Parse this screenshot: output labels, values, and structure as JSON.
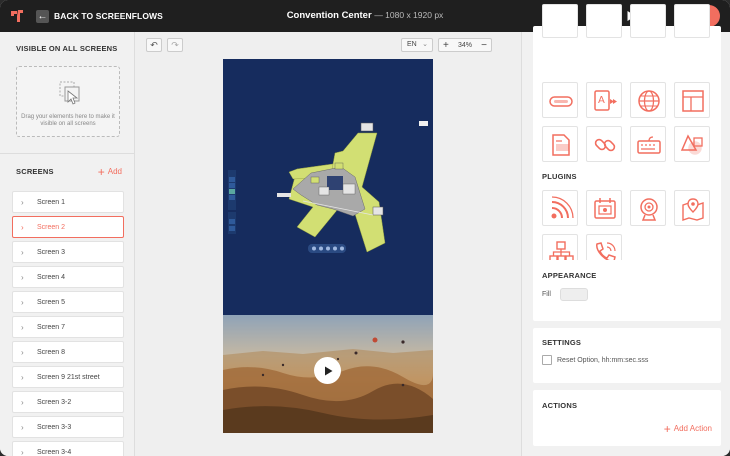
{
  "topbar": {
    "back_label": "BACK TO SCREENFLOWS",
    "title": "Convention Center",
    "title_dims": "— 1080 x 1920 px",
    "icons": [
      "gear-icon",
      "play-icon",
      "save-icon",
      "upload-icon"
    ],
    "accent": "#f26e5f"
  },
  "left": {
    "visible_header": "VISIBLE ON ALL SCREENS",
    "drop_hint": "Drag your elements here to make it visible on all screens",
    "screens_header": "SCREENS",
    "add_label": "Add",
    "screens": [
      {
        "label": "Screen 1",
        "active": false
      },
      {
        "label": "Screen 2",
        "active": true
      },
      {
        "label": "Screen 3",
        "active": false
      },
      {
        "label": "Screen 4",
        "active": false
      },
      {
        "label": "Screen 5",
        "active": false
      },
      {
        "label": "Screen 7",
        "active": false
      },
      {
        "label": "Screen 8",
        "active": false
      },
      {
        "label": "Screen 9 21st street",
        "active": false
      },
      {
        "label": "Screen 3-2",
        "active": false
      },
      {
        "label": "Screen 3-3",
        "active": false
      },
      {
        "label": "Screen 3-4",
        "active": false
      }
    ]
  },
  "canvas": {
    "language": "EN",
    "zoom": "34%"
  },
  "right": {
    "plugins_header": "PLUGINS",
    "appearance_header": "APPEARANCE",
    "fill_label": "Fill",
    "settings_header": "SETTINGS",
    "reset_option": "Reset Option, hh:mm:sec.sss",
    "actions_header": "ACTIONS",
    "add_action": "Add Action",
    "widget_icons": [
      "button-icon",
      "text-to-speech-icon",
      "web-icon",
      "layout-icon",
      "document-icon",
      "link-icon",
      "keyboard-icon",
      "shapes-icon"
    ],
    "plugin_icons": [
      "rss-icon",
      "calendar-icon",
      "webcam-icon",
      "map-icon",
      "hierarchy-icon",
      "phone-icon"
    ]
  }
}
